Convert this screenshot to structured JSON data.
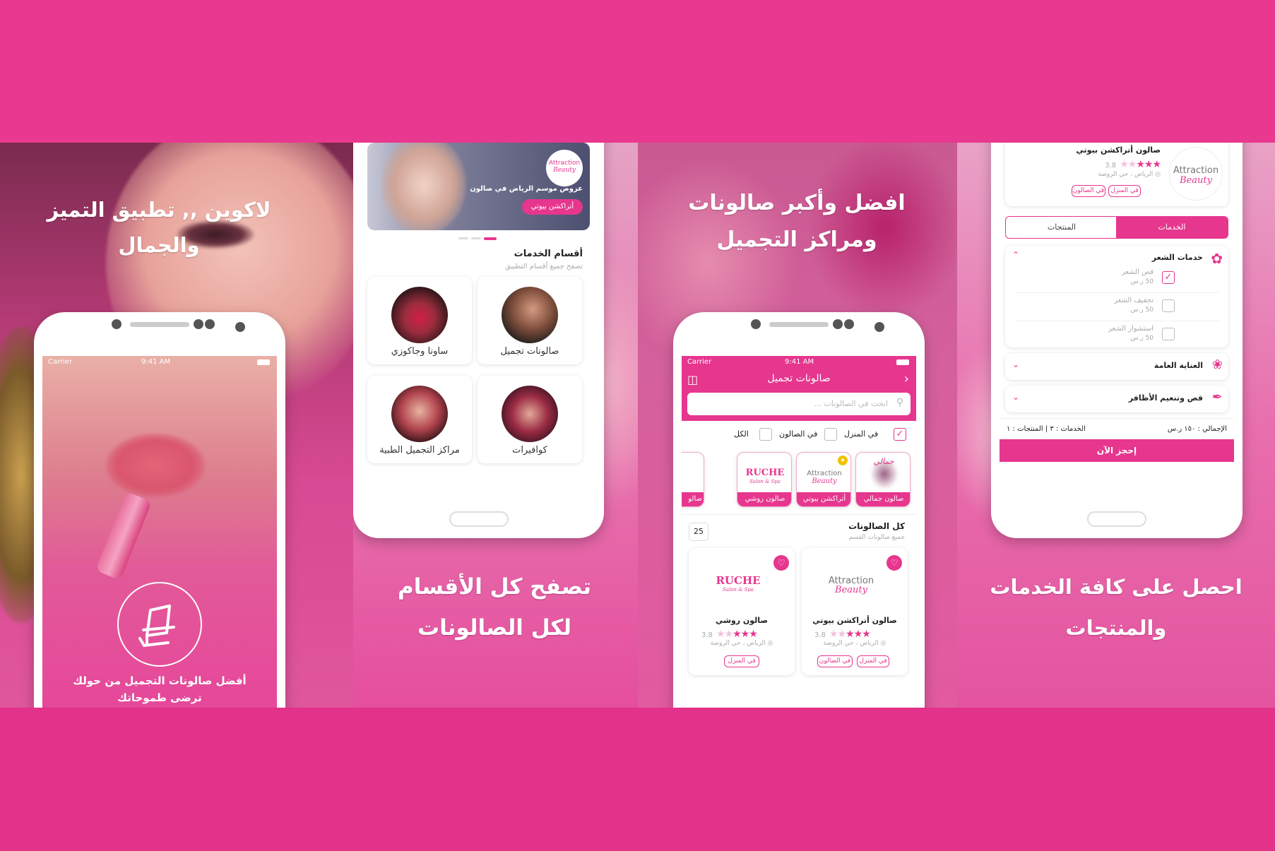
{
  "colors": {
    "brand": "#e6368e",
    "band": "#e8388f",
    "white": "#ffffff"
  },
  "panel1": {
    "headline_line1": "لاكوين ,, تطبيق التميز",
    "headline_line2": "والجمال",
    "status_carrier": "Carrier",
    "status_time": "9:41 AM",
    "icon": "salon-chair-icon",
    "tagline_line1": "أفضل صالونات التجميل من حولك",
    "tagline_line2": "ترضى طموحاتك"
  },
  "panel2": {
    "banner_title": "عروض موسم الرياض في صالون",
    "banner_button": "أتراكشن بيوتي",
    "banner_logo_line1": "Attraction",
    "banner_logo_line2": "Beauty",
    "section_title": "أقسام الخدمات",
    "section_subtitle": "تصفح جميع أقسام التطبيق",
    "categories": [
      {
        "label": "صالونات تجميل"
      },
      {
        "label": "ساونا وجاكوزي"
      },
      {
        "label": "كوافيرات"
      },
      {
        "label": "مراكز التجميل الطبية"
      }
    ],
    "headline_line1": "تصفح كل الأقسام",
    "headline_line2": "لكل الصالونات"
  },
  "panel3": {
    "headline_line1": "افضل وأكبر صالونات",
    "headline_line2": "ومراكز التجميل",
    "status_carrier": "Carrier",
    "status_time": "9:41 AM",
    "appbar_title": "صالونات تجميل",
    "search_placeholder": "ابحث في الصالونات ...",
    "filters": [
      {
        "label": "في المنزل",
        "checked": true
      },
      {
        "label": "في الصالون",
        "checked": false
      },
      {
        "label": "الكل",
        "checked": false
      }
    ],
    "featured": [
      {
        "name": "صالون جمالي",
        "logo": "جمالي"
      },
      {
        "name": "أتراكشن بيوتي",
        "logo_line1": "Attraction",
        "logo_line2": "Beauty"
      },
      {
        "name": "صالون روشي",
        "logo_line1": "RUCHE",
        "logo_line2": "Salon & Spa"
      },
      {
        "name": "صالو"
      }
    ],
    "all_title": "كل الصالونات",
    "all_subtitle": "جميع صالونات القسم",
    "count": "25",
    "salons": [
      {
        "name": "صالون أتراكشن بيوتي",
        "rating": "3.8",
        "stars": 3,
        "location": "الرياض ، حي الروضة",
        "tags": [
          "في المنزل",
          "في الصالون"
        ],
        "logo_line1": "Attraction",
        "logo_line2": "Beauty"
      },
      {
        "name": "صالون روشي",
        "rating": "3.8",
        "stars": 3,
        "location": "الرياض ، حي الروضة",
        "tags": [
          "في المنزل"
        ],
        "logo_line1": "RUCHE",
        "logo_line2": "Salon & Spa"
      }
    ]
  },
  "panel4": {
    "salon_name": "صالون أتراكشن بيوتي",
    "rating": "3.8",
    "stars": 3,
    "location": "الرياض ، حي الروضة",
    "tags": [
      "في المنزل",
      "في الصالون"
    ],
    "logo_line1": "Attraction",
    "logo_line2": "Beauty",
    "tab_services": "الخدمات",
    "tab_products": "المنتجات",
    "group_hair": "خدمات الشعر",
    "services": [
      {
        "name": "قص الشعر",
        "price": "50 ر.س",
        "checked": true
      },
      {
        "name": "تجفيف الشعر",
        "price": "50 ر.س",
        "checked": false
      },
      {
        "name": "استشوار الشعر",
        "price": "50 ر.س",
        "checked": false
      }
    ],
    "group_care": "العناية العامة",
    "group_nails": "قص وتنعيم الأظافر",
    "summary_total": "الإجمالي : ١٥٠ ر.س",
    "summary_counts": "الخدمات : ٣ | المنتجات : ١",
    "book_button": "إحجز الآن",
    "headline_line1": "احصل على كافة الخدمات",
    "headline_line2": "والمنتجات"
  }
}
